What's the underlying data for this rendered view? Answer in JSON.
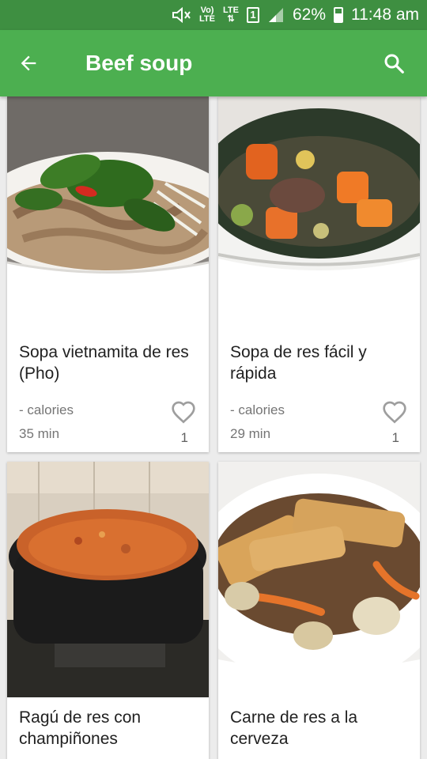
{
  "status_bar": {
    "volte": "Vo)\nLTE",
    "lte": "LTE",
    "sim": "1",
    "battery": "62%",
    "time": "11:48 am"
  },
  "app_bar": {
    "title": "Beef soup",
    "back_icon": "arrow-back-icon",
    "search_icon": "search-icon"
  },
  "recipes": [
    {
      "title": "Sopa vietnamita de res (Pho)",
      "calories": "- calories",
      "time": "35 min",
      "likes": "1"
    },
    {
      "title": "Sopa de res fácil y rápida",
      "calories": "- calories",
      "time": "29 min",
      "likes": "1"
    },
    {
      "title": "Ragú de res con champiñones"
    },
    {
      "title": "Carne de res a la cerveza"
    }
  ],
  "colors": {
    "app_bar": "#4caf50",
    "status_bar": "#3e8f41",
    "heart": "#9e9e9e"
  }
}
